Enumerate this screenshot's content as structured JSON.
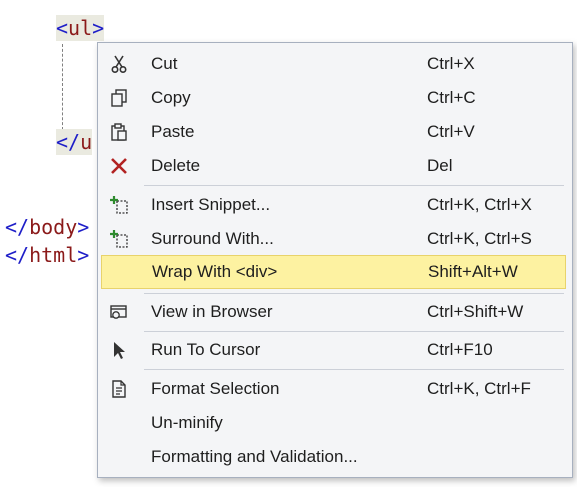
{
  "code": {
    "ul_open": {
      "open": "<",
      "name": "ul",
      "close": ">"
    },
    "ul_close": {
      "open": "</",
      "name": "u"
    },
    "body_close": {
      "open": "</",
      "name": "body",
      "close": ">"
    },
    "html_close": {
      "open": "</",
      "name": "html",
      "close": ">"
    }
  },
  "menu": {
    "items": [
      {
        "label": "Cut",
        "shortcut": "Ctrl+X",
        "icon": "scissors-icon"
      },
      {
        "label": "Copy",
        "shortcut": "Ctrl+C",
        "icon": "copy-icon"
      },
      {
        "label": "Paste",
        "shortcut": "Ctrl+V",
        "icon": "paste-icon"
      },
      {
        "label": "Delete",
        "shortcut": "Del",
        "icon": "delete-x-icon"
      },
      {
        "label": "Insert Snippet...",
        "shortcut": "Ctrl+K, Ctrl+X",
        "icon": "insert-snippet-icon"
      },
      {
        "label": "Surround With...",
        "shortcut": "Ctrl+K, Ctrl+S",
        "icon": "surround-with-icon"
      },
      {
        "label": "Wrap With <div>",
        "shortcut": "Shift+Alt+W",
        "icon": "",
        "highlighted": true
      },
      {
        "label": "View in Browser",
        "shortcut": "Ctrl+Shift+W",
        "icon": "browser-icon"
      },
      {
        "label": "Run To Cursor",
        "shortcut": "Ctrl+F10",
        "icon": "cursor-arrow-icon"
      },
      {
        "label": "Format Selection",
        "shortcut": "Ctrl+K, Ctrl+F",
        "icon": "format-document-icon"
      },
      {
        "label": "Un-minify",
        "shortcut": "",
        "icon": ""
      },
      {
        "label": "Formatting and Validation...",
        "shortcut": "",
        "icon": ""
      }
    ]
  },
  "colors": {
    "highlight": "#fdf2a1",
    "bracket": "#1e1ec8",
    "tagname": "#8b1a1a",
    "delete_icon": "#b22222",
    "snippet_plus": "#2e8b2e"
  }
}
